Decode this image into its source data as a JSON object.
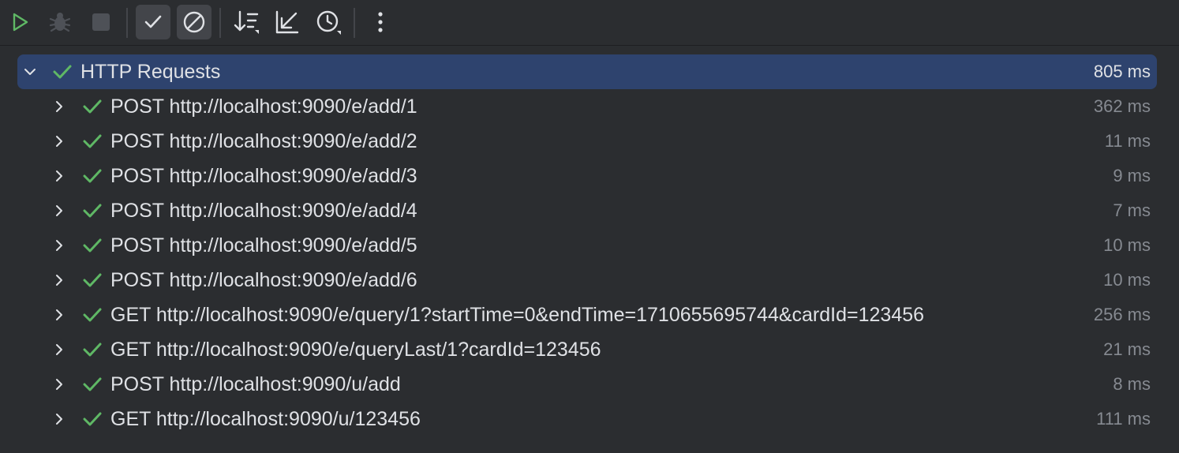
{
  "toolbar": {
    "buttons": [
      {
        "name": "run-icon",
        "tooltip": ""
      },
      {
        "name": "debug-icon",
        "tooltip": ""
      },
      {
        "name": "stop-icon",
        "tooltip": ""
      },
      {
        "name": "show-passed-icon",
        "tooltip": ""
      },
      {
        "name": "show-ignored-icon",
        "tooltip": ""
      },
      {
        "name": "sort-icon",
        "tooltip": ""
      },
      {
        "name": "collapse-icon",
        "tooltip": ""
      },
      {
        "name": "history-icon",
        "tooltip": ""
      },
      {
        "name": "more-icon",
        "tooltip": ""
      }
    ]
  },
  "colors": {
    "background": "#2b2d30",
    "selection": "#2e436e",
    "success": "#5fb865",
    "run": "#5fb865",
    "text": "#dfe1e5",
    "muted": "#868a91"
  },
  "tree": {
    "root": {
      "label": "HTTP Requests",
      "duration": "805 ms",
      "status": "passed",
      "expanded": true
    },
    "children": [
      {
        "label": "POST http://localhost:9090/e/add/1",
        "duration": "362 ms",
        "status": "passed"
      },
      {
        "label": "POST http://localhost:9090/e/add/2",
        "duration": "11 ms",
        "status": "passed"
      },
      {
        "label": "POST http://localhost:9090/e/add/3",
        "duration": "9 ms",
        "status": "passed"
      },
      {
        "label": "POST http://localhost:9090/e/add/4",
        "duration": "7 ms",
        "status": "passed"
      },
      {
        "label": "POST http://localhost:9090/e/add/5",
        "duration": "10 ms",
        "status": "passed"
      },
      {
        "label": "POST http://localhost:9090/e/add/6",
        "duration": "10 ms",
        "status": "passed"
      },
      {
        "label": "GET http://localhost:9090/e/query/1?startTime=0&endTime=1710655695744&cardId=123456",
        "duration": "256 ms",
        "status": "passed"
      },
      {
        "label": "GET http://localhost:9090/e/queryLast/1?cardId=123456",
        "duration": "21 ms",
        "status": "passed"
      },
      {
        "label": "POST http://localhost:9090/u/add",
        "duration": "8 ms",
        "status": "passed"
      },
      {
        "label": "GET http://localhost:9090/u/123456",
        "duration": "111 ms",
        "status": "passed"
      }
    ]
  }
}
